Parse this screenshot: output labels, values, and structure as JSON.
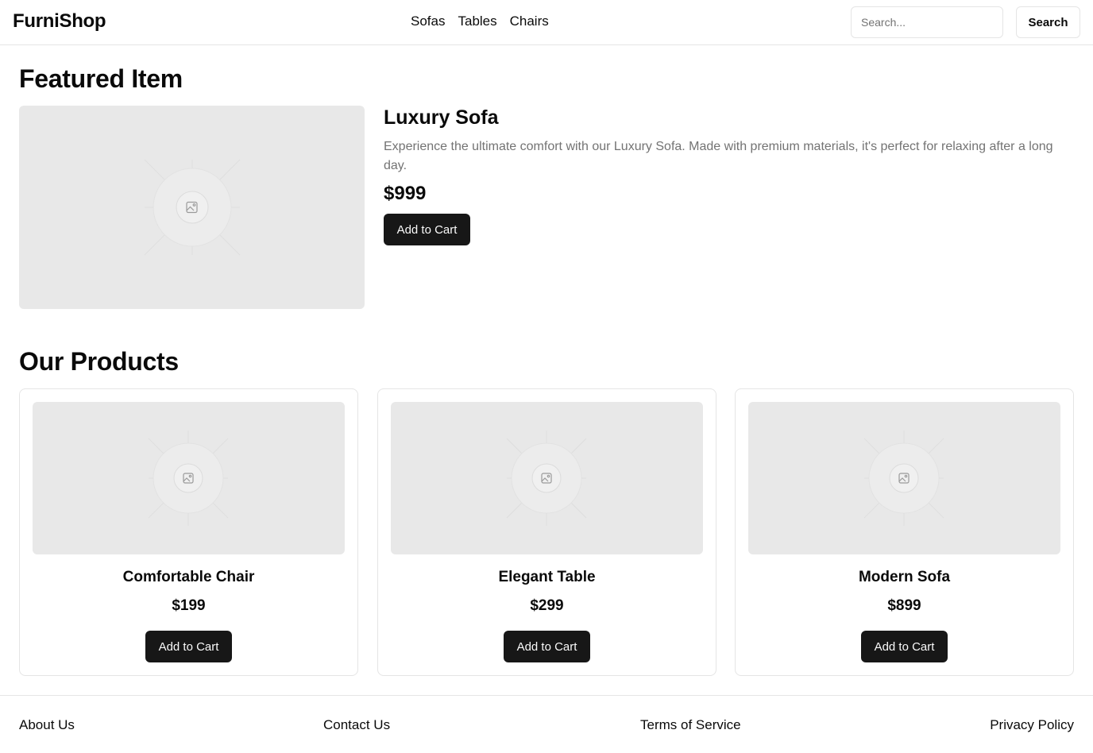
{
  "header": {
    "brand": "FurniShop",
    "nav": [
      "Sofas",
      "Tables",
      "Chairs"
    ],
    "search_placeholder": "Search...",
    "search_button": "Search"
  },
  "featured": {
    "heading": "Featured Item",
    "title": "Luxury Sofa",
    "description": "Experience the ultimate comfort with our Luxury Sofa. Made with premium materials, it's perfect for relaxing after a long day.",
    "price": "$999",
    "button": "Add to Cart",
    "image_icon": "image-placeholder-icon"
  },
  "products": {
    "heading": "Our Products",
    "items": [
      {
        "name": "Comfortable Chair",
        "price": "$199",
        "button": "Add to Cart"
      },
      {
        "name": "Elegant Table",
        "price": "$299",
        "button": "Add to Cart"
      },
      {
        "name": "Modern Sofa",
        "price": "$899",
        "button": "Add to Cart"
      }
    ]
  },
  "footer": {
    "links": [
      "About Us",
      "Contact Us",
      "Terms of Service",
      "Privacy Policy"
    ]
  },
  "colors": {
    "primary_button": "#171717",
    "muted_text": "#737373",
    "border": "#e5e5e5",
    "placeholder_bg": "#e8e8e8"
  }
}
